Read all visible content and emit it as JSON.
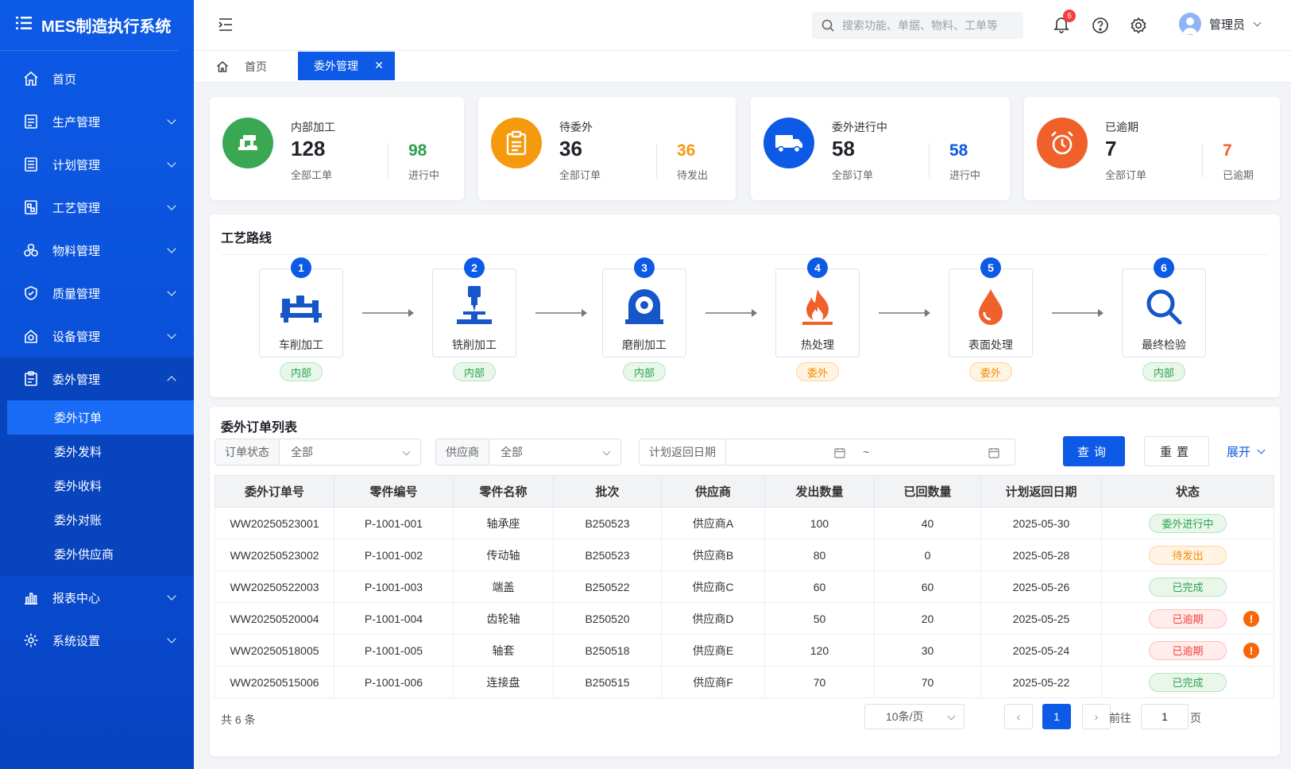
{
  "app": {
    "title": "MES制造执行系统"
  },
  "sidebar": {
    "items": [
      {
        "label": "首页",
        "icon": "home-icon"
      },
      {
        "label": "生产管理",
        "icon": "production-icon"
      },
      {
        "label": "计划管理",
        "icon": "plan-icon"
      },
      {
        "label": "工艺管理",
        "icon": "process-icon"
      },
      {
        "label": "物料管理",
        "icon": "material-icon"
      },
      {
        "label": "质量管理",
        "icon": "quality-icon"
      },
      {
        "label": "设备管理",
        "icon": "equipment-icon"
      },
      {
        "label": "委外管理",
        "icon": "outsource-icon"
      },
      {
        "label": "报表中心",
        "icon": "report-icon"
      },
      {
        "label": "系统设置",
        "icon": "settings-icon"
      }
    ],
    "submenu": [
      "委外订单",
      "委外发料",
      "委外收料",
      "委外对账",
      "委外供应商"
    ]
  },
  "header": {
    "search_placeholder": "搜索功能、单据、物料、工单等",
    "notification_count": "6",
    "user_name": "管理员"
  },
  "tabs": {
    "home": "首页",
    "active": "委外管理"
  },
  "stats": [
    {
      "label": "内部加工",
      "value": "128",
      "sub": "全部工单",
      "value2": "98",
      "sub2": "进行中",
      "color": "#2ba24c"
    },
    {
      "label": "待委外",
      "value": "36",
      "sub": "全部订单",
      "value2": "36",
      "sub2": "待发出",
      "color": "#f59a0c"
    },
    {
      "label": "委外进行中",
      "value": "58",
      "sub": "全部订单",
      "value2": "58",
      "sub2": "进行中",
      "color": "#0d5ae6"
    },
    {
      "label": "已逾期",
      "value": "7",
      "sub": "全部订单",
      "value2": "7",
      "sub2": "已逾期",
      "color": "#f0602b"
    }
  ],
  "route": {
    "title": "工艺路线",
    "steps": [
      {
        "num": "1",
        "name": "车削加工",
        "tag": "内部",
        "type": "in",
        "icon": "lathe-icon"
      },
      {
        "num": "2",
        "name": "铣削加工",
        "tag": "内部",
        "type": "in",
        "icon": "milling-icon"
      },
      {
        "num": "3",
        "name": "磨削加工",
        "tag": "内部",
        "type": "in",
        "icon": "grinding-icon"
      },
      {
        "num": "4",
        "name": "热处理",
        "tag": "委外",
        "type": "out",
        "icon": "fire-icon"
      },
      {
        "num": "5",
        "name": "表面处理",
        "tag": "委外",
        "type": "out",
        "icon": "droplet-icon"
      },
      {
        "num": "6",
        "name": "最终检验",
        "tag": "内部",
        "type": "in",
        "icon": "magnifier-icon"
      }
    ]
  },
  "orders": {
    "title": "委外订单列表",
    "filters": {
      "status_label": "订单状态",
      "status_value": "全部",
      "supplier_label": "供应商",
      "supplier_value": "全部",
      "date_label": "计划返回日期",
      "date_sep": "~"
    },
    "query_button": "查询",
    "reset_button": "重置",
    "expand_button": "展开",
    "columns": [
      "委外订单号",
      "零件编号",
      "零件名称",
      "批次",
      "供应商",
      "发出数量",
      "已回数量",
      "计划返回日期",
      "状态"
    ],
    "rows": [
      [
        "WW20250523001",
        "P-1001-001",
        "轴承座",
        "B250523",
        "供应商A",
        "100",
        "40",
        "2025-05-30",
        "委外进行中"
      ],
      [
        "WW20250523002",
        "P-1001-002",
        "传动轴",
        "B250523",
        "供应商B",
        "80",
        "0",
        "2025-05-28",
        "待发出"
      ],
      [
        "WW20250522003",
        "P-1001-003",
        "端盖",
        "B250522",
        "供应商C",
        "60",
        "60",
        "2025-05-26",
        "已完成"
      ],
      [
        "WW20250520004",
        "P-1001-004",
        "齿轮轴",
        "B250520",
        "供应商D",
        "50",
        "20",
        "2025-05-25",
        "已逾期"
      ],
      [
        "WW20250518005",
        "P-1001-005",
        "轴套",
        "B250518",
        "供应商E",
        "120",
        "30",
        "2025-05-24",
        "已逾期"
      ],
      [
        "WW20250515006",
        "P-1001-006",
        "连接盘",
        "B250515",
        "供应商F",
        "70",
        "70",
        "2025-05-22",
        "已完成"
      ]
    ],
    "status_styles": {
      "委外进行中": "green",
      "待发出": "orange",
      "已完成": "green",
      "已逾期": "red"
    },
    "total": "共 6 条",
    "page_size": "10条/页",
    "current_page": "1",
    "goto_label": "前往",
    "goto_value": "1",
    "page_word": "页"
  }
}
